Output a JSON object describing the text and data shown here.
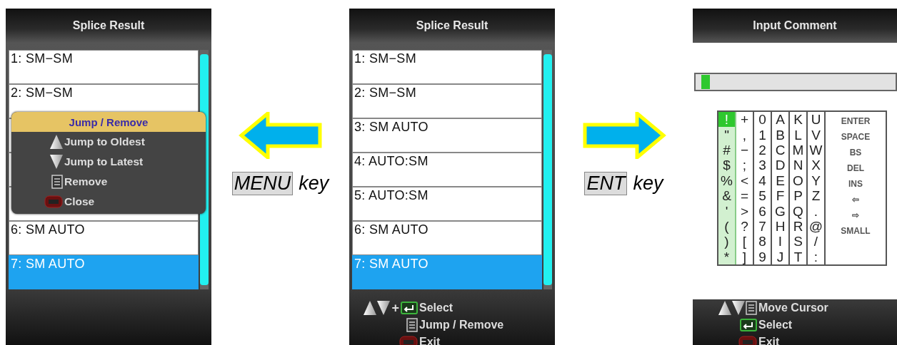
{
  "panels": [
    {
      "kind": "list-screen",
      "title": "Splice Result",
      "rows": [
        {
          "label": "1: SM−SM",
          "selected": false
        },
        {
          "label": "2: SM−SM",
          "selected": false
        },
        {
          "selected": false
        },
        {
          "selected": false
        },
        {
          "selected": false
        },
        {
          "label": "6: SM AUTO",
          "selected": false
        },
        {
          "label": "7: SM AUTO",
          "selected": true
        }
      ],
      "popup": {
        "title": "Jump / Remove",
        "items": [
          {
            "kind": "up",
            "label": "Jump to Oldest"
          },
          {
            "kind": "down",
            "label": "Jump to Latest"
          },
          {
            "kind": "menu",
            "label": "Remove"
          },
          {
            "kind": "esc",
            "label": "Close"
          }
        ]
      }
    },
    {
      "kind": "left-arrow",
      "key": "MENU",
      "suffix": "key"
    },
    {
      "kind": "list-screen",
      "title": "Splice Result",
      "rows": [
        {
          "label": "1: SM−SM",
          "selected": false
        },
        {
          "label": "2: SM−SM",
          "selected": false
        },
        {
          "label": "3: SM AUTO",
          "selected": false
        },
        {
          "label": "4: AUTO:SM",
          "selected": false
        },
        {
          "label": "5: AUTO:SM",
          "selected": false
        },
        {
          "label": "6: SM AUTO",
          "selected": false
        },
        {
          "label": "7: SM AUTO",
          "selected": true
        }
      ],
      "hints": [
        {
          "kind": "arrows-enter",
          "prefix": "+",
          "label": "Select"
        },
        {
          "kind": "menu",
          "label": "Jump / Remove"
        },
        {
          "kind": "esc",
          "label": "Exit"
        }
      ]
    },
    {
      "kind": "right-arrow",
      "key": "ENT",
      "suffix": "key"
    },
    {
      "kind": "keyboard-screen",
      "title": "Input Comment",
      "input": {
        "focused": true
      },
      "keyboard": {
        "columns": [
          {
            "keys": [
              {
                "char": "!",
                "selected": true
              },
              {
                "char": "\"",
                "selected": false
              },
              {
                "char": "#",
                "selected": false
              },
              {
                "char": "$",
                "selected": false
              },
              {
                "char": "%",
                "selected": false
              },
              {
                "char": "&",
                "selected": false
              },
              {
                "char": "'",
                "selected": false
              },
              {
                "char": "(",
                "selected": false
              },
              {
                "char": ")",
                "selected": false
              },
              {
                "char": "*",
                "selected": false
              }
            ]
          },
          {
            "keys": [
              {
                "char": "+",
                "selected": false
              },
              {
                "char": ",",
                "selected": false
              },
              {
                "char": "−",
                "selected": false
              },
              {
                "char": ";",
                "selected": false
              },
              {
                "char": "<",
                "selected": false
              },
              {
                "char": "=",
                "selected": false
              },
              {
                "char": ">",
                "selected": false
              },
              {
                "char": "?",
                "selected": false
              },
              {
                "char": "[",
                "selected": false
              },
              {
                "char": "]",
                "selected": false
              }
            ]
          },
          {
            "keys": [
              {
                "char": "0",
                "selected": false
              },
              {
                "char": "1",
                "selected": false
              },
              {
                "char": "2",
                "selected": false
              },
              {
                "char": "3",
                "selected": false
              },
              {
                "char": "4",
                "selected": false
              },
              {
                "char": "5",
                "selected": false
              },
              {
                "char": "6",
                "selected": false
              },
              {
                "char": "7",
                "selected": false
              },
              {
                "char": "8",
                "selected": false
              },
              {
                "char": "9",
                "selected": false
              }
            ]
          },
          {
            "keys": [
              {
                "char": "A",
                "selected": false
              },
              {
                "char": "B",
                "selected": false
              },
              {
                "char": "C",
                "selected": false
              },
              {
                "char": "D",
                "selected": false
              },
              {
                "char": "E",
                "selected": false
              },
              {
                "char": "F",
                "selected": false
              },
              {
                "char": "G",
                "selected": false
              },
              {
                "char": "H",
                "selected": false
              },
              {
                "char": "I",
                "selected": false
              },
              {
                "char": "J",
                "selected": false
              }
            ]
          },
          {
            "keys": [
              {
                "char": "K",
                "selected": false
              },
              {
                "char": "L",
                "selected": false
              },
              {
                "char": "M",
                "selected": false
              },
              {
                "char": "N",
                "selected": false
              },
              {
                "char": "O",
                "selected": false
              },
              {
                "char": "P",
                "selected": false
              },
              {
                "char": "Q",
                "selected": false
              },
              {
                "char": "R",
                "selected": false
              },
              {
                "char": "S",
                "selected": false
              },
              {
                "char": "T",
                "selected": false
              }
            ]
          },
          {
            "keys": [
              {
                "char": "U",
                "selected": false
              },
              {
                "char": "V",
                "selected": false
              },
              {
                "char": "W",
                "selected": false
              },
              {
                "char": "X",
                "selected": false
              },
              {
                "char": "Y",
                "selected": false
              },
              {
                "char": "Z",
                "selected": false
              },
              {
                "char": ".",
                "selected": false
              },
              {
                "char": "@",
                "selected": false
              },
              {
                "char": "/",
                "selected": false
              },
              {
                "char": ":",
                "selected": false
              }
            ]
          }
        ],
        "commands": [
          {
            "label": "ENTER",
            "selected": false
          },
          {
            "label": "SPACE",
            "selected": false
          },
          {
            "label": "BS",
            "selected": false
          },
          {
            "label": "DEL",
            "selected": false
          },
          {
            "label": "INS",
            "selected": false
          },
          {
            "label": "⇦",
            "selected": false
          },
          {
            "label": "⇨",
            "selected": false
          },
          {
            "label": "SMALL",
            "selected": false
          }
        ]
      },
      "hints": [
        {
          "kind": "arrows-menu",
          "label": "Move Cursor"
        },
        {
          "kind": "enter",
          "label": "Select"
        },
        {
          "kind": "esc",
          "label": "Exit"
        }
      ]
    }
  ]
}
